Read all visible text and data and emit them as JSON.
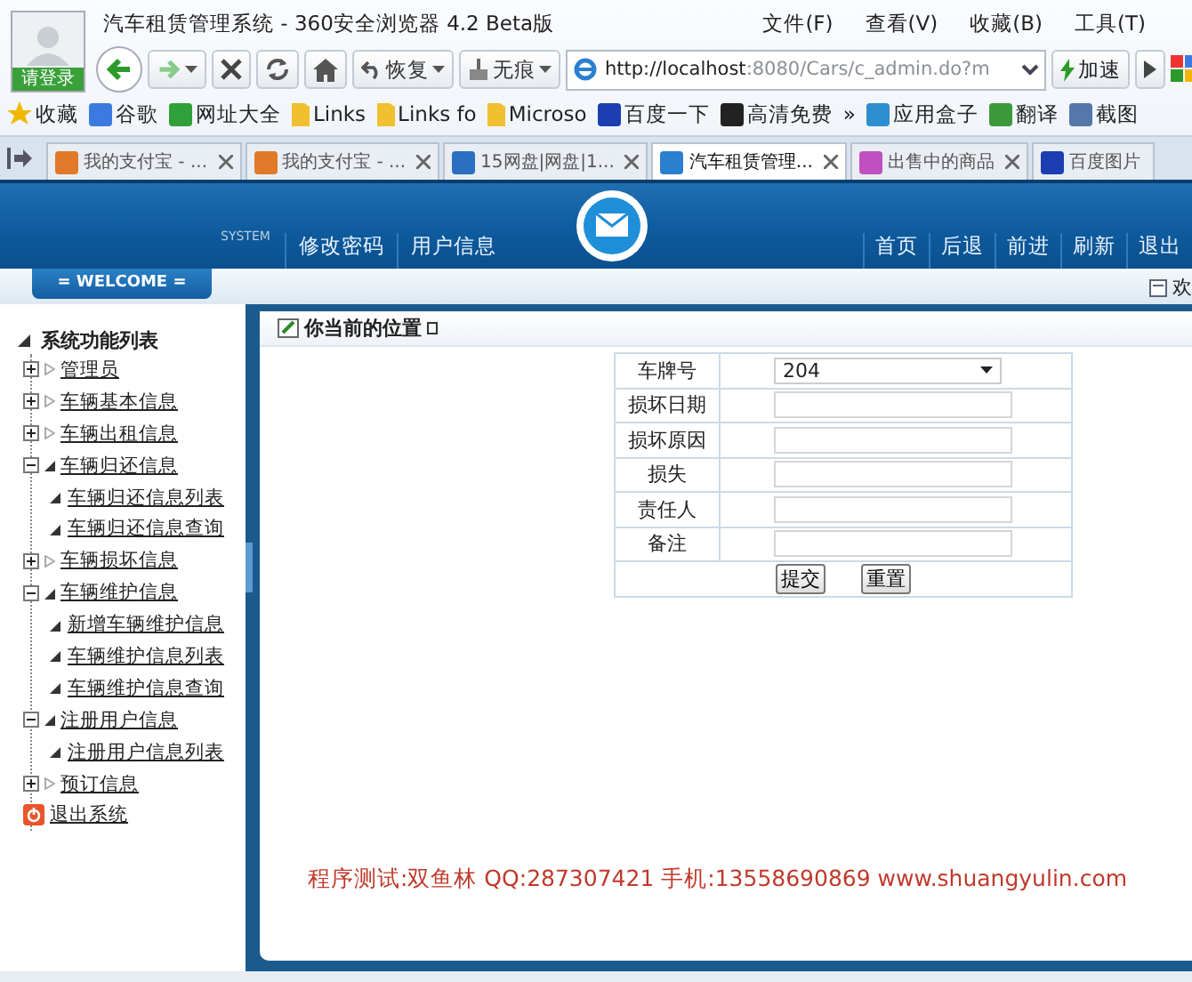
{
  "browser": {
    "login": "请登录",
    "title": "汽车租赁管理系统 - 360安全浏览器 4.2 Beta版",
    "menu": [
      "文件(F)",
      "查看(V)",
      "收藏(B)",
      "工具(T)"
    ],
    "restore": "恢复",
    "incognito": "无痕",
    "address_host": "http://localhost",
    "address_rest": ":8080/Cars/c_admin.do?m",
    "speedup": "加速",
    "bookmarks": [
      "收藏",
      "谷歌",
      "网址大全",
      "Links",
      "Links fo",
      "Microso",
      "百度一下",
      "高清免费",
      "»",
      "应用盒子",
      "翻译",
      "截图"
    ],
    "tabs": [
      {
        "label": "我的支付宝 - ...",
        "selected": false
      },
      {
        "label": "我的支付宝 - ...",
        "selected": false
      },
      {
        "label": "15网盘|网盘|1...",
        "selected": false
      },
      {
        "label": "汽车租赁管理...",
        "selected": true
      },
      {
        "label": "出售中的商品",
        "selected": false
      },
      {
        "label": "百度图片",
        "selected": false
      }
    ]
  },
  "app": {
    "system": "SYSTEM",
    "left_links": [
      "修改密码",
      "用户信息"
    ],
    "right_links": [
      "首页",
      "后退",
      "前进",
      "刷新",
      "退出"
    ],
    "welcome": "= WELCOME =",
    "welcome_right": "欢",
    "tree": {
      "label": "系统功能列表",
      "expanded": true,
      "children": [
        {
          "label": "管理员",
          "kind": "folder",
          "expanded": false
        },
        {
          "label": "车辆基本信息",
          "kind": "folder",
          "expanded": false
        },
        {
          "label": "车辆出租信息",
          "kind": "folder",
          "expanded": false
        },
        {
          "label": "车辆归还信息",
          "kind": "folder",
          "expanded": true,
          "children": [
            {
              "label": "车辆归还信息列表",
              "kind": "leaf"
            },
            {
              "label": "车辆归还信息查询",
              "kind": "leaf"
            }
          ]
        },
        {
          "label": "车辆损坏信息",
          "kind": "folder",
          "expanded": false
        },
        {
          "label": "车辆维护信息",
          "kind": "folder",
          "expanded": true,
          "children": [
            {
              "label": "新增车辆维护信息",
              "kind": "leaf"
            },
            {
              "label": "车辆维护信息列表",
              "kind": "leaf"
            },
            {
              "label": "车辆维护信息查询",
              "kind": "leaf"
            }
          ]
        },
        {
          "label": "注册用户信息",
          "kind": "folder",
          "expanded": true,
          "children": [
            {
              "label": "注册用户信息列表",
              "kind": "leaf"
            }
          ]
        },
        {
          "label": "预订信息",
          "kind": "folder",
          "expanded": false
        },
        {
          "label": "退出系统",
          "kind": "exit"
        }
      ]
    },
    "location": "你当前的位置",
    "form": [
      {
        "label": "车牌号",
        "kind": "select",
        "value": "204"
      },
      {
        "label": "损坏日期",
        "kind": "input"
      },
      {
        "label": "损坏原因",
        "kind": "input"
      },
      {
        "label": "损失",
        "kind": "input"
      },
      {
        "label": "责任人",
        "kind": "input"
      },
      {
        "label": "备注",
        "kind": "input"
      }
    ],
    "buttons": [
      "提交",
      "重置"
    ],
    "footer": "程序测试:双鱼林 QQ:287307421 手机:13558690869 www.shuangyulin.com"
  }
}
